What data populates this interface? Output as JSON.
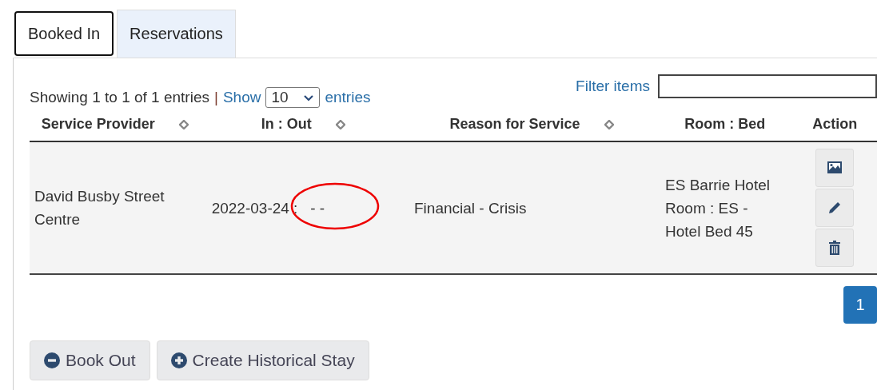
{
  "tabs": [
    {
      "label": "Booked In",
      "selected": true
    },
    {
      "label": "Reservations",
      "selected": false
    }
  ],
  "info": {
    "showing": "Showing 1 to 1 of 1 entries",
    "separator": "|",
    "show_label": "Show",
    "page_size": "10",
    "entries_label": "entries"
  },
  "filter": {
    "label": "Filter items"
  },
  "table": {
    "columns": [
      {
        "label": "Service Provider",
        "sortable": true
      },
      {
        "label": "In : Out",
        "sortable": true
      },
      {
        "label": "Reason for Service",
        "sortable": true
      },
      {
        "label": "Room : Bed",
        "sortable": false
      },
      {
        "label": "Action",
        "sortable": false
      }
    ],
    "rows": [
      {
        "service_provider": "David Busby Street Centre",
        "in_out": "2022-03-24 :",
        "out": "- -",
        "circled": true,
        "reason": "Financial - Crisis",
        "room_bed": "ES Barrie Hotel Room : ES - Hotel Bed 45",
        "actions": [
          {
            "kind": "image"
          },
          {
            "kind": "edit"
          },
          {
            "kind": "delete"
          }
        ]
      }
    ]
  },
  "pagination": [
    {
      "label": "1",
      "selected": true
    }
  ],
  "buttons": [
    {
      "label": "Book Out",
      "kind": "minus"
    },
    {
      "label": "Create Historical Stay",
      "kind": "plus"
    }
  ]
}
